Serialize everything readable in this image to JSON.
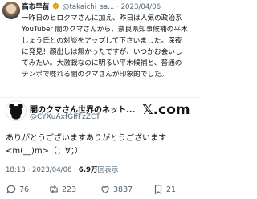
{
  "quote_tweet": {
    "display_name": "高市早苗",
    "handle": "@takaichi_sa...",
    "separator": "·",
    "date": "2023/04/06",
    "lines": [
      "一昨日のヒロクマさんに加え、昨日は人気の政治系",
      "YouTuber 闇のクマさんから、奈良県知事候補の平木",
      "しょう氏との対談をアップして下さいました。深夜",
      "に発見！顔出しは無かったですが、いつかお会いし",
      "てみたい。大激戦なのに明るい平木候補と、普通の",
      "テンポで喋れる闇のクマさんが印象的でした。"
    ]
  },
  "tweet": {
    "display_name": "闇のクマさん世界のネット...",
    "handle": "@CYXuAxfGIfFzZCT",
    "brand_logo_text": "𝕏.com",
    "text_lines": [
      "ありがとうございますありがとうございます",
      "<m(__)m>（；∀；）"
    ],
    "meta": {
      "time": "18:13",
      "separator": "·",
      "date": "2023/04/06",
      "views_count": "6.9万",
      "views_label": "回表示"
    }
  },
  "actions": {
    "reply_count": "76",
    "retweet_count": "223",
    "like_count": "3837",
    "bookmark_count": "21"
  },
  "colors": {
    "text_primary": "#0f1419",
    "text_secondary": "#536471",
    "badge_gold": "#d4a017",
    "divider": "#eff3f4"
  }
}
